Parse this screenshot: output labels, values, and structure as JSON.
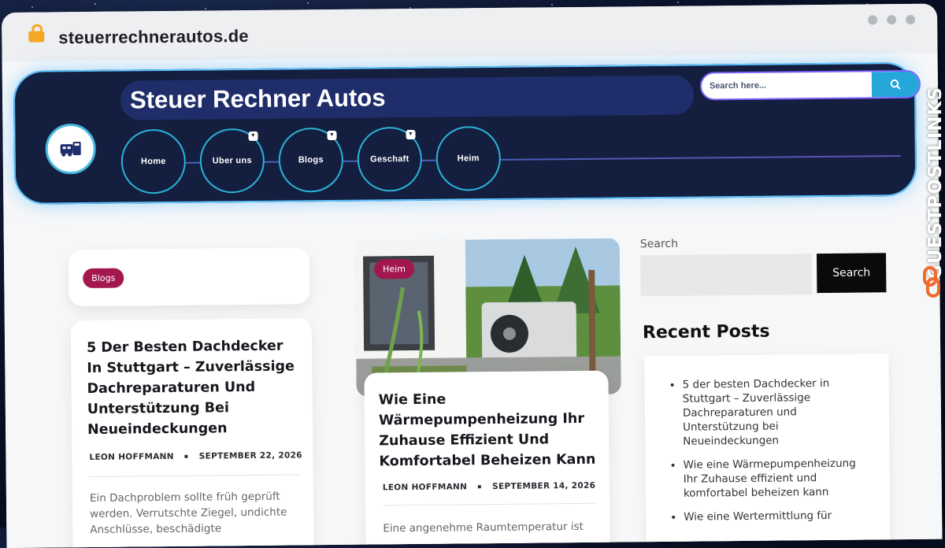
{
  "browser": {
    "url": "steuerrechnerautos.de"
  },
  "header": {
    "site_title": "Steuer Rechner Autos",
    "search_placeholder": "Search here...",
    "nav": [
      {
        "label": "Home"
      },
      {
        "label": "Uber uns"
      },
      {
        "label": "Blogs"
      },
      {
        "label": "Geschaft"
      },
      {
        "label": "Heim"
      }
    ]
  },
  "posts": [
    {
      "category": "Blogs",
      "title": "5 Der Besten Dachdecker In Stuttgart – Zuverlässige Dachreparaturen Und Unterstützung Bei Neueindeckungen",
      "author": "LEON HOFFMANN",
      "date": "SEPTEMBER 22, 2026",
      "excerpt": "Ein Dachproblem sollte früh geprüft werden. Verrutschte Ziegel, undichte Anschlüsse, beschädigte"
    },
    {
      "category": "Heim",
      "title": "Wie Eine Wärmepumpenheizung Ihr Zuhause Effizient Und Komfortabel Beheizen Kann",
      "author": "LEON HOFFMANN",
      "date": "SEPTEMBER 14, 2026",
      "excerpt": "Eine angenehme Raumtemperatur ist"
    }
  ],
  "sidebar": {
    "search_label": "Search",
    "search_button": "Search",
    "recent_title": "Recent Posts",
    "recent_posts": [
      "5 der besten Dachdecker in Stuttgart – Zuverlässige Dachreparaturen und Unterstützung bei Neueindeckungen",
      "Wie eine Wärmepumpenheizung Ihr Zuhause effizient und komfortabel beheizen kann",
      "Wie eine Wertermittlung für"
    ]
  },
  "watermark": "GUESTPOSTLINKS",
  "colors": {
    "header_bg": "#141f3f",
    "accent_cyan": "#25a7da",
    "badge": "#a3174f"
  }
}
